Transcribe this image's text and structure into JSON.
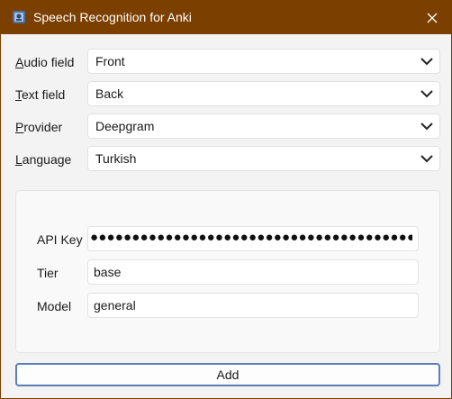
{
  "window": {
    "title": "Speech Recognition for Anki",
    "icon": "app-icon",
    "close_icon": "close-icon"
  },
  "form": {
    "audio_field": {
      "label_underline": "A",
      "label_rest": "udio field",
      "value": "Front"
    },
    "text_field": {
      "label_underline": "T",
      "label_rest": "ext field",
      "value": "Back"
    },
    "provider": {
      "label_underline": "P",
      "label_rest": "rovider",
      "value": "Deepgram"
    },
    "language": {
      "label_underline": "L",
      "label_rest": "anguage",
      "value": "Turkish"
    }
  },
  "settings": {
    "api_key": {
      "label": "API Key",
      "value": "●●●●●●●●●●●●●●●●●●●●●●●●●●●●●●●●●●●●●●●●●●"
    },
    "tier": {
      "label": "Tier",
      "value": "base"
    },
    "model": {
      "label": "Model",
      "value": "general"
    }
  },
  "actions": {
    "add_label": "Add"
  },
  "colors": {
    "titlebar": "#7b3f00",
    "button_border": "#5a7fb8"
  }
}
